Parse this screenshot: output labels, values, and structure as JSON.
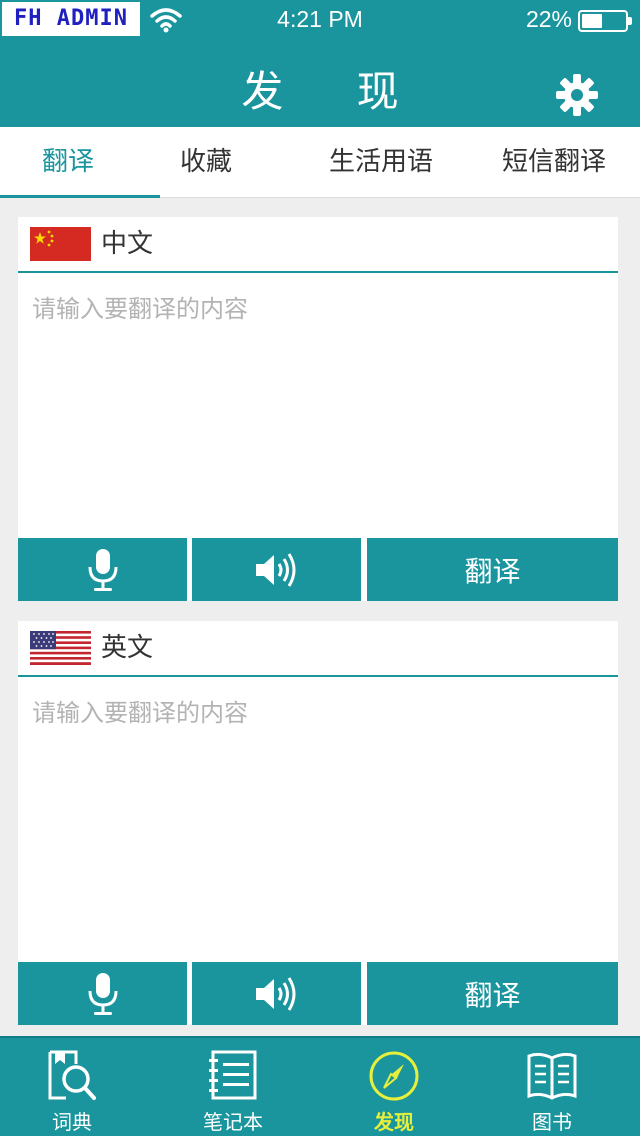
{
  "status_bar": {
    "carrier": "FH ADMIN",
    "time": "4:21 PM",
    "battery_percent": "22%",
    "battery_level": 0.22
  },
  "header": {
    "title": "发 现",
    "settings_icon": "gear-icon"
  },
  "tabs": [
    {
      "label": "翻译",
      "active": true
    },
    {
      "label": "收藏",
      "active": false
    },
    {
      "label": "生活用语",
      "active": false
    },
    {
      "label": "短信翻译",
      "active": false
    }
  ],
  "source_panel": {
    "flag_icon": "china-flag-icon",
    "language": "中文",
    "input_value": "",
    "placeholder": "请输入要翻译的内容",
    "mic_icon": "microphone-icon",
    "speaker_icon": "speaker-icon",
    "translate_label": "翻译"
  },
  "target_panel": {
    "flag_icon": "usa-flag-icon",
    "language": "英文",
    "input_value": "",
    "placeholder": "请输入要翻译的内容",
    "mic_icon": "microphone-icon",
    "speaker_icon": "speaker-icon",
    "translate_label": "翻译"
  },
  "bottom_nav": [
    {
      "label": "词典",
      "icon": "dictionary-search-icon",
      "active": false
    },
    {
      "label": "笔记本",
      "icon": "notebook-icon",
      "active": false
    },
    {
      "label": "发现",
      "icon": "compass-icon",
      "active": true
    },
    {
      "label": "图书",
      "icon": "open-book-icon",
      "active": false
    }
  ],
  "colors": {
    "accent": "#1a959e",
    "active_nav": "#e6ef3a",
    "placeholder": "#b3b3b3",
    "background": "#eeeeee"
  }
}
